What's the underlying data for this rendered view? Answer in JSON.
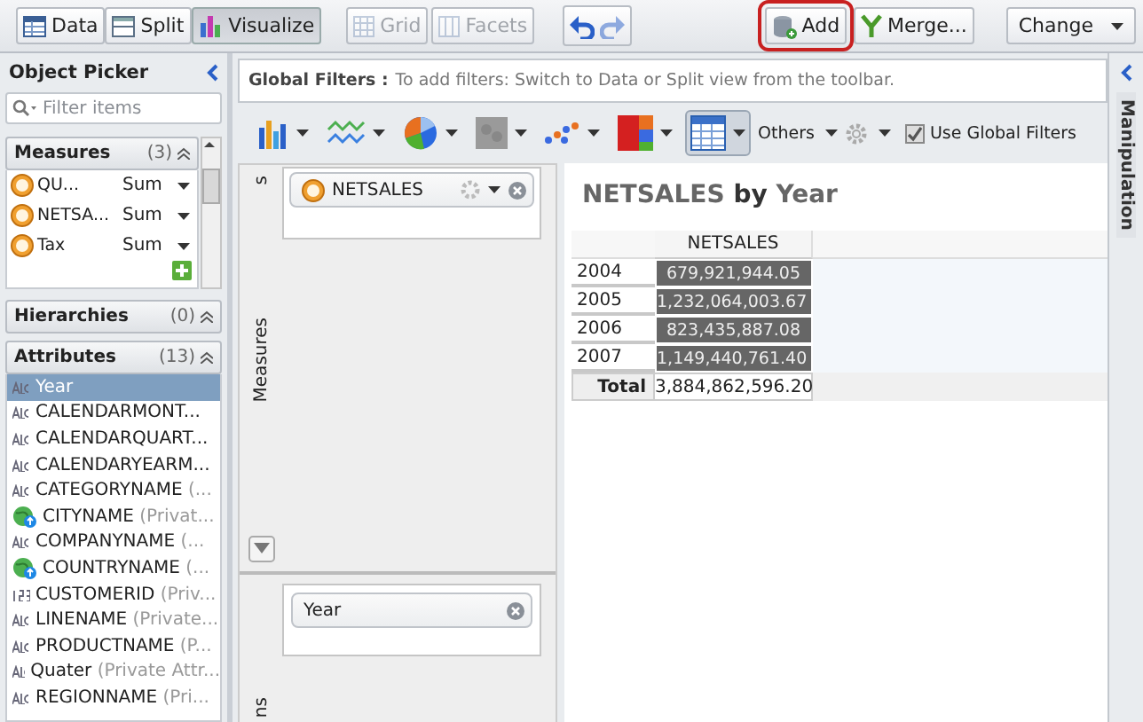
{
  "toolbar": {
    "views": [
      {
        "label": "Data",
        "kind": "data",
        "selected": false
      },
      {
        "label": "Split",
        "kind": "split",
        "selected": false
      },
      {
        "label": "Visualize",
        "kind": "visualize",
        "selected": true
      }
    ],
    "layout_buttons": [
      {
        "label": "Grid",
        "kind": "grid",
        "disabled": true
      },
      {
        "label": "Facets",
        "kind": "facets",
        "disabled": true
      }
    ],
    "actions": [
      {
        "label": "Add",
        "kind": "add",
        "highlighted": true
      },
      {
        "label": "Merge...",
        "kind": "merge",
        "highlighted": false
      }
    ],
    "change": {
      "label": "Change"
    }
  },
  "object_picker": {
    "title": "Object Picker",
    "filter": {
      "placeholder": "Filter items"
    },
    "measures": {
      "title": "Measures",
      "count": "(3)",
      "items": [
        {
          "name": "QU...",
          "aggregation": "Sum"
        },
        {
          "name": "NETSA...",
          "aggregation": "Sum"
        },
        {
          "name": "Tax",
          "aggregation": "Sum"
        }
      ]
    },
    "hierarchies": {
      "title": "Hierarchies",
      "count": "(0)"
    },
    "attributes": {
      "title": "Attributes",
      "count": "(13)",
      "items": [
        {
          "name": "Year",
          "kind": "text",
          "selected": true
        },
        {
          "name": "CALENDARMONT...",
          "kind": "text",
          "selected": false
        },
        {
          "name": "CALENDARQUART...",
          "kind": "text",
          "selected": false
        },
        {
          "name": "CALENDARYEARM...",
          "kind": "text",
          "selected": false
        },
        {
          "name": "CATEGORYNAME",
          "note": "(...",
          "kind": "text",
          "selected": false
        },
        {
          "name": "CITYNAME",
          "note": "(Privat...",
          "kind": "geo",
          "selected": false
        },
        {
          "name": "COMPANYNAME",
          "note": "(...",
          "kind": "text",
          "selected": false
        },
        {
          "name": "COUNTRYNAME",
          "note": "(...",
          "kind": "geo",
          "selected": false
        },
        {
          "name": "CUSTOMERID",
          "note": "(Priv...",
          "kind": "number",
          "selected": false
        },
        {
          "name": "LINENAME",
          "note": "(Private...",
          "kind": "text",
          "selected": false
        },
        {
          "name": "PRODUCTNAME",
          "note": "(P...",
          "kind": "text",
          "selected": false
        },
        {
          "name": "Quater",
          "note": "(Private Attr...",
          "kind": "text",
          "selected": false
        },
        {
          "name": "REGIONNAME",
          "note": "(Pri...",
          "kind": "text",
          "selected": false
        }
      ]
    }
  },
  "global_filters": {
    "label": "Global Filters :",
    "hint": "To add filters: Switch to Data or Split view from the toolbar."
  },
  "chart_picker": {
    "types": [
      {
        "kind": "bar",
        "selected": false
      },
      {
        "kind": "line",
        "selected": false
      },
      {
        "kind": "pie",
        "selected": false
      },
      {
        "kind": "geo",
        "selected": false
      },
      {
        "kind": "scatter",
        "selected": false
      },
      {
        "kind": "tree",
        "selected": false
      },
      {
        "kind": "table",
        "selected": true
      }
    ],
    "others": "Others",
    "use_global_filters": {
      "label": "Use Global Filters",
      "checked": true
    }
  },
  "drop_zones": [
    {
      "label": "s",
      "pills": [
        {
          "name": "NETSALES",
          "kind": "measure"
        }
      ]
    },
    {
      "label": "Measures"
    },
    {
      "label": "ns",
      "pills": [
        {
          "name": "Year",
          "kind": "dimension"
        }
      ]
    }
  ],
  "result": {
    "title": "NETSALES **by** Year",
    "column": "NETSALES",
    "rows": [
      {
        "label": "2004",
        "value": "679,921,944.05"
      },
      {
        "label": "2005",
        "value": "1,232,064,003.67"
      },
      {
        "label": "2006",
        "value": "823,435,887.08"
      },
      {
        "label": "2007",
        "value": "1,149,440,761.40"
      }
    ],
    "total": {
      "label": "Total",
      "value": "3,884,862,596.20"
    }
  },
  "side_tab": {
    "label": "Manipulation"
  }
}
